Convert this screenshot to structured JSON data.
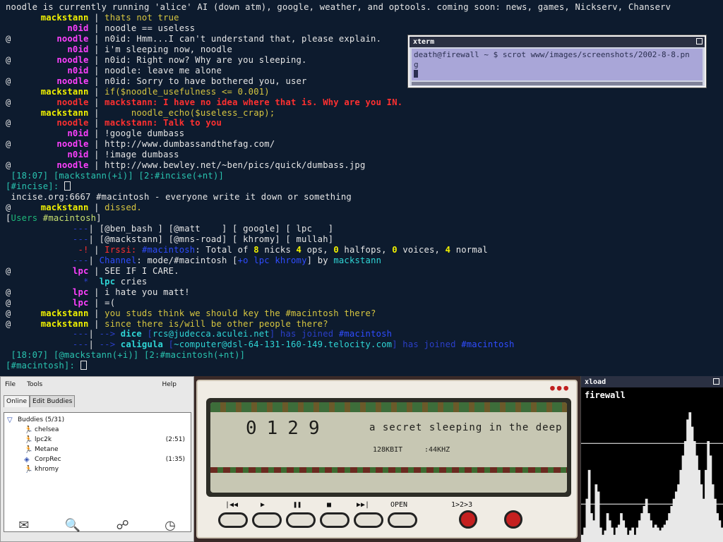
{
  "irc": {
    "lines": [
      {
        "parts": [
          {
            "t": "noodle is currently running 'alice' AI (down atm), google, weather, and optools. coming soon: news, games, Nickserv, Chanserv",
            "c": "c-w"
          }
        ]
      },
      {
        "op": " ",
        "nick": "mackstann",
        "nc": "c-y",
        "sep": " | ",
        "parts": [
          {
            "t": "thats not true",
            "c": "c-yl"
          }
        ]
      },
      {
        "op": " ",
        "nick": "n0id",
        "nc": "c-m",
        "sep": " | ",
        "parts": [
          {
            "t": "noodle == useless",
            "c": "c-w"
          }
        ]
      },
      {
        "op": "@",
        "nick": "noodle",
        "nc": "c-m",
        "sep": " | ",
        "parts": [
          {
            "t": "n0id: Hmm...I can't understand that, please explain.",
            "c": "c-w"
          }
        ]
      },
      {
        "op": " ",
        "nick": "n0id",
        "nc": "c-m",
        "sep": " | ",
        "parts": [
          {
            "t": "i'm sleeping now, noodle",
            "c": "c-w"
          }
        ]
      },
      {
        "op": "@",
        "nick": "noodle",
        "nc": "c-m",
        "sep": " | ",
        "parts": [
          {
            "t": "n0id: Right now? Why are you sleeping.",
            "c": "c-w"
          }
        ]
      },
      {
        "op": " ",
        "nick": "n0id",
        "nc": "c-m",
        "sep": " | ",
        "parts": [
          {
            "t": "noodle: leave me alone",
            "c": "c-w"
          }
        ]
      },
      {
        "op": "@",
        "nick": "noodle",
        "nc": "c-m",
        "sep": " | ",
        "parts": [
          {
            "t": "n0id: Sorry to have bothered you, user",
            "c": "c-w"
          }
        ]
      },
      {
        "op": " ",
        "nick": "mackstann",
        "nc": "c-y",
        "sep": " | ",
        "parts": [
          {
            "t": "if($noodle_usefulness <= 0.001)",
            "c": "c-yl"
          }
        ]
      },
      {
        "op": "@",
        "nick": "noodle",
        "nc": "c-r",
        "sep": " | ",
        "parts": [
          {
            "t": "mackstann: I have no idea where that is. Why are you IN.",
            "c": "c-r"
          }
        ]
      },
      {
        "op": " ",
        "nick": "mackstann",
        "nc": "c-y",
        "sep": " | ",
        "parts": [
          {
            "t": "     noodle_echo($useless_crap);",
            "c": "c-yl"
          }
        ]
      },
      {
        "op": "@",
        "nick": "noodle",
        "nc": "c-r",
        "sep": " | ",
        "parts": [
          {
            "t": "mackstann: Talk to you",
            "c": "c-r"
          }
        ]
      },
      {
        "op": " ",
        "nick": "n0id",
        "nc": "c-m",
        "sep": " | ",
        "parts": [
          {
            "t": "!google dumbass",
            "c": "c-w"
          }
        ]
      },
      {
        "op": "@",
        "nick": "noodle",
        "nc": "c-m",
        "sep": " | ",
        "parts": [
          {
            "t": "http://www.dumbassandthefag.com/",
            "c": "c-w"
          }
        ]
      },
      {
        "op": " ",
        "nick": "n0id",
        "nc": "c-m",
        "sep": " | ",
        "parts": [
          {
            "t": "!image dumbass",
            "c": "c-w"
          }
        ]
      },
      {
        "op": "@",
        "nick": "noodle",
        "nc": "c-m",
        "sep": " | ",
        "parts": [
          {
            "t": "http://www.bewley.net/~ben/pics/quick/dumbass.jpg",
            "c": "c-w"
          }
        ]
      },
      {
        "parts": [
          {
            "t": " [18:07] [mackstann(+i)] [2:#incise(+nt)]",
            "c": "c-g"
          }
        ]
      },
      {
        "parts": [
          {
            "t": "[#incise]: ",
            "c": "c-g"
          }
        ],
        "cursor": true
      },
      {
        "parts": [
          {
            "t": " incise.org:6667 #macintosh - everyone write it down or something",
            "c": "c-w"
          }
        ]
      },
      {
        "op": "@",
        "nick": "mackstann",
        "nc": "c-y",
        "sep": " | ",
        "parts": [
          {
            "t": "dissed.",
            "c": "c-yl"
          }
        ]
      },
      {
        "parts": [
          {
            "t": "[",
            "c": "c-w"
          },
          {
            "t": "Users ",
            "c": "c-gr"
          },
          {
            "t": "#macintosh",
            "c": "c-lg"
          },
          {
            "t": "]",
            "c": "c-w"
          }
        ]
      },
      {
        "nick": "---",
        "nc": "c-db",
        "sep": "| ",
        "parts": [
          {
            "t": "[@ben_bash ] [@matt    ] [ google] [ lpc   ]",
            "c": "c-w"
          }
        ]
      },
      {
        "nick": "---",
        "nc": "c-db",
        "sep": "| ",
        "parts": [
          {
            "t": "[@mackstann] [@mns-road] [ khromy] [ mullah]",
            "c": "c-w"
          }
        ]
      },
      {
        "nick": "-!",
        "nc": "c-rr",
        "sep": " | ",
        "parts": [
          {
            "t": "Irssi: ",
            "c": "c-rr"
          },
          {
            "t": "#macintosh",
            "c": "c-b"
          },
          {
            "t": ": Total of ",
            "c": "c-w"
          },
          {
            "t": "8",
            "c": "c-y"
          },
          {
            "t": " nicks ",
            "c": "c-w"
          },
          {
            "t": "4",
            "c": "c-y"
          },
          {
            "t": " ops, ",
            "c": "c-w"
          },
          {
            "t": "0",
            "c": "c-y"
          },
          {
            "t": " halfops, ",
            "c": "c-w"
          },
          {
            "t": "0",
            "c": "c-y"
          },
          {
            "t": " voices, ",
            "c": "c-w"
          },
          {
            "t": "4",
            "c": "c-y"
          },
          {
            "t": " normal",
            "c": "c-w"
          }
        ]
      },
      {
        "nick": "---",
        "nc": "c-db",
        "sep": "| ",
        "parts": [
          {
            "t": "Channel",
            "c": "c-b"
          },
          {
            "t": ": mode/#macintosh ",
            "c": "c-w"
          },
          {
            "t": "[",
            "c": "c-w"
          },
          {
            "t": "+o lpc khromy",
            "c": "c-b"
          },
          {
            "t": "]",
            "c": "c-w"
          },
          {
            "t": " by ",
            "c": "c-w"
          },
          {
            "t": "mackstann",
            "c": "c-n"
          }
        ]
      },
      {
        "op": "@",
        "nick": "lpc",
        "nc": "c-m",
        "sep": " | ",
        "parts": [
          {
            "t": "SEE IF I CARE.",
            "c": "c-w"
          }
        ]
      },
      {
        "op": " ",
        "nick": "  *",
        "nc": "c-db",
        "sep": "",
        "parts": [
          {
            "t": "  lpc",
            "c": "c-c"
          },
          {
            "t": " cries",
            "c": "c-w"
          }
        ],
        "actionStyle": true
      },
      {
        "op": "@",
        "nick": "lpc",
        "nc": "c-m",
        "sep": " | ",
        "parts": [
          {
            "t": "i hate you matt!",
            "c": "c-w"
          }
        ]
      },
      {
        "op": "@",
        "nick": "lpc",
        "nc": "c-m",
        "sep": " | ",
        "parts": [
          {
            "t": "=(",
            "c": "c-w"
          }
        ]
      },
      {
        "op": "@",
        "nick": "mackstann",
        "nc": "c-y",
        "sep": " | ",
        "parts": [
          {
            "t": "you studs think we should key the #macintosh there?",
            "c": "c-yl"
          }
        ]
      },
      {
        "op": "@",
        "nick": "mackstann",
        "nc": "c-y",
        "sep": " | ",
        "parts": [
          {
            "t": "since there is/will be other people there?",
            "c": "c-yl"
          }
        ]
      },
      {
        "nick": "---",
        "nc": "c-db",
        "sep": "| ",
        "parts": [
          {
            "t": "--> ",
            "c": "c-db"
          },
          {
            "t": "dice ",
            "c": "c-c"
          },
          {
            "t": "[",
            "c": "c-db"
          },
          {
            "t": "rcs@judecca.aculei.net",
            "c": "c-n"
          },
          {
            "t": "] has joined ",
            "c": "c-db"
          },
          {
            "t": "#macintosh",
            "c": "c-b"
          }
        ]
      },
      {
        "nick": "---",
        "nc": "c-db",
        "sep": "| ",
        "parts": [
          {
            "t": "--> ",
            "c": "c-db"
          },
          {
            "t": "caligula ",
            "c": "c-c"
          },
          {
            "t": "[",
            "c": "c-db"
          },
          {
            "t": "~computer@dsl-64-131-160-149.telocity.com",
            "c": "c-n"
          },
          {
            "t": "] has joined ",
            "c": "c-db"
          },
          {
            "t": "#macintosh",
            "c": "c-b"
          }
        ]
      },
      {
        "parts": [
          {
            "t": " [18:07] [@mackstann(+i)] [2:#macintosh(+nt)]",
            "c": "c-g"
          }
        ]
      },
      {
        "parts": [
          {
            "t": "[#macintosh]: ",
            "c": "c-g"
          }
        ],
        "cursor": true
      }
    ]
  },
  "xterm": {
    "title": "xterm",
    "line1": "death@firewall ~ $ scrot www/images/screenshots/2002-8-8.pn",
    "line2": "g"
  },
  "buddy_list": {
    "menu": {
      "file": "File",
      "tools": "Tools",
      "help": "Help"
    },
    "tabs": [
      "Online",
      "Edit Buddies"
    ],
    "group": "Buddies (5/31)",
    "buddies": [
      {
        "name": "chelsea",
        "idle": "",
        "icon": "running-man-icon"
      },
      {
        "name": "lpc2k",
        "idle": "(2:51)",
        "icon": "running-man-icon"
      },
      {
        "name": "Metane",
        "idle": "",
        "icon": "running-man-icon"
      },
      {
        "name": "CorpRec",
        "idle": "(1:35)",
        "icon": "away-icon"
      },
      {
        "name": "khromy",
        "idle": "",
        "icon": "running-man-icon"
      }
    ]
  },
  "player": {
    "time": "0129",
    "song": "a secret sleeping in the deep",
    "kbit": "128KBIT",
    "khz": ":44KHZ",
    "open_label": "OPEN",
    "repeat_label": "1>2>3"
  },
  "xload": {
    "title": "xload",
    "host": "firewall",
    "load_samples": [
      0.05,
      0.1,
      0.3,
      0.5,
      0.2,
      0.15,
      0.4,
      0.35,
      0.1,
      0.05,
      0.08,
      0.2,
      0.15,
      0.1,
      0.05,
      0.1,
      0.12,
      0.2,
      0.15,
      0.1,
      0.05,
      0.08,
      0.1,
      0.05,
      0.1,
      0.15,
      0.2,
      0.25,
      0.3,
      0.2,
      0.15,
      0.1,
      0.12,
      0.1,
      0.08,
      0.1,
      0.12,
      0.15,
      0.2,
      0.25,
      0.3,
      0.35,
      0.4,
      0.5,
      0.6,
      0.7,
      0.85,
      0.9,
      0.8,
      0.7,
      0.6,
      0.5,
      0.4,
      0.3,
      0.5,
      0.7,
      0.6,
      0.4,
      0.3,
      0.2,
      0.15,
      0.1
    ]
  }
}
